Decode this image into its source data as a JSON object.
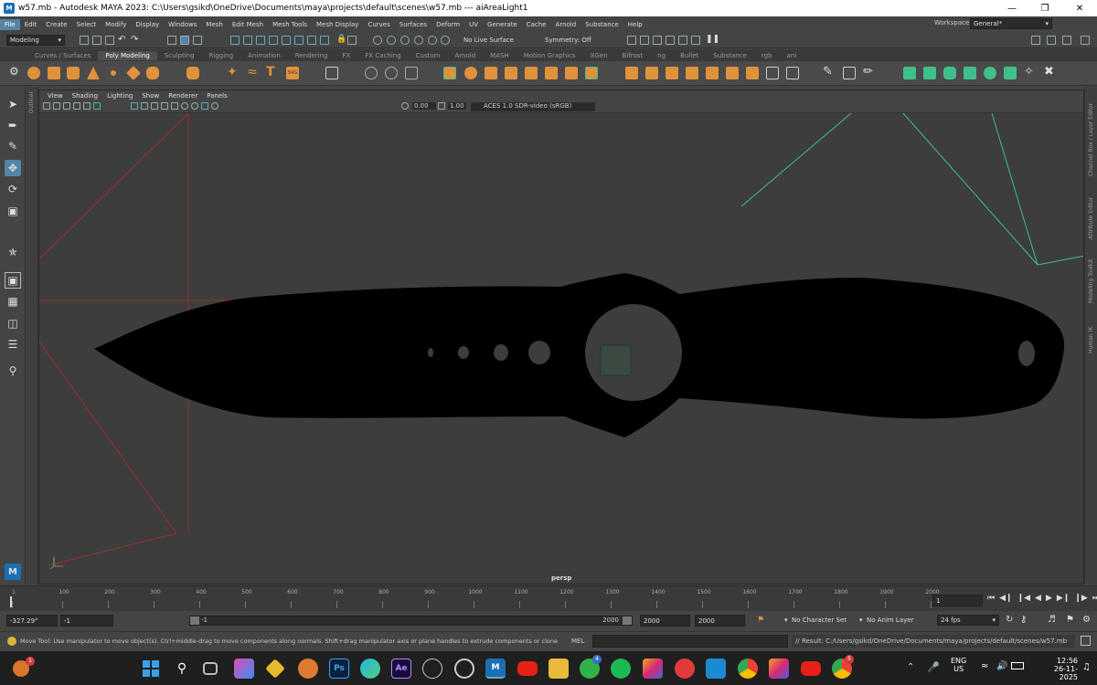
{
  "titlebar": {
    "title": "w57.mb - Autodesk MAYA 2023: C:\\Users\\gsikd\\OneDrive\\Documents\\maya\\projects\\default\\scenes\\w57.mb  ---  aiAreaLight1",
    "app_icon": "M"
  },
  "menubar": {
    "items": [
      "File",
      "Edit",
      "Create",
      "Select",
      "Modify",
      "Display",
      "Windows",
      "Mesh",
      "Edit Mesh",
      "Mesh Tools",
      "Mesh Display",
      "Curves",
      "Surfaces",
      "Deform",
      "UV",
      "Generate",
      "Cache",
      "Arnold",
      "Substance",
      "Help"
    ],
    "workspace_label": "Workspace:",
    "workspace_value": "General*"
  },
  "statusline": {
    "mode": "Modeling",
    "live_surface": "No Live Surface",
    "symmetry": "Symmetry: Off"
  },
  "shelf": {
    "tabs": [
      "Curves / Surfaces",
      "Poly Modeling",
      "Sculpting",
      "Rigging",
      "Animation",
      "Rendering",
      "FX",
      "FX Caching",
      "Custom",
      "Arnold",
      "MASH",
      "Motion Graphics",
      "XGen",
      "Bifrost",
      "ng",
      "Bullet",
      "Substance",
      "rgb",
      "ani"
    ],
    "active_tab": "Poly Modeling"
  },
  "panel": {
    "menus": [
      "View",
      "Shading",
      "Lighting",
      "Show",
      "Renderer",
      "Panels"
    ],
    "exposure": "0.00",
    "gamma": "1.00",
    "colorspace": "ACES 1.0 SDR-video (sRGB)",
    "camera_label": "persp"
  },
  "side_labels": {
    "left": "Outliner",
    "right_top": "Channel Box / Layer Editor",
    "right_mid": "Attribute Editor",
    "right_low": "Modeling Toolkit",
    "right_bot": "Human IK"
  },
  "timeline": {
    "ticks": [
      "1",
      "100",
      "200",
      "300",
      "400",
      "500",
      "600",
      "700",
      "800",
      "900",
      "1000",
      "1100",
      "1200",
      "1300",
      "1400",
      "1500",
      "1600",
      "1700",
      "1800",
      "1900",
      "2000"
    ],
    "current_frame": "1"
  },
  "range": {
    "coord": "-327.29°",
    "start": "-1",
    "slider_start": "-1",
    "slider_end": "2000",
    "end1": "2000",
    "end2": "2000",
    "char_set": "No Character Set",
    "anim_layer": "No Anim Layer",
    "fps": "24 fps"
  },
  "helpline": {
    "text": "Move Tool: Use manipulator to move object(s). Ctrl+middle-drag to move components along normals. Shift+drag manipulator axis or plane handles to extrude components or clone objects. Ctrl+Shift+drag to con",
    "mel_label": "MEL",
    "result": "// Result: C:/Users/gsikd/OneDrive/Documents/maya/projects/default/scenes/w57.mb"
  },
  "taskbar": {
    "lang": "ENG",
    "region": "US",
    "time": "12:56",
    "date": "26-11-2025",
    "weather_badge": "1",
    "whatsapp_badge": "4",
    "chrome_badge": "5",
    "ps_label": "Ps",
    "ae_label": "Ae",
    "maya_label": "M"
  },
  "colors": {
    "accent": "#5285a6",
    "light_green": "#3fbf8a",
    "camera_red": "#b03030",
    "orange_icon": "#e0913c"
  }
}
